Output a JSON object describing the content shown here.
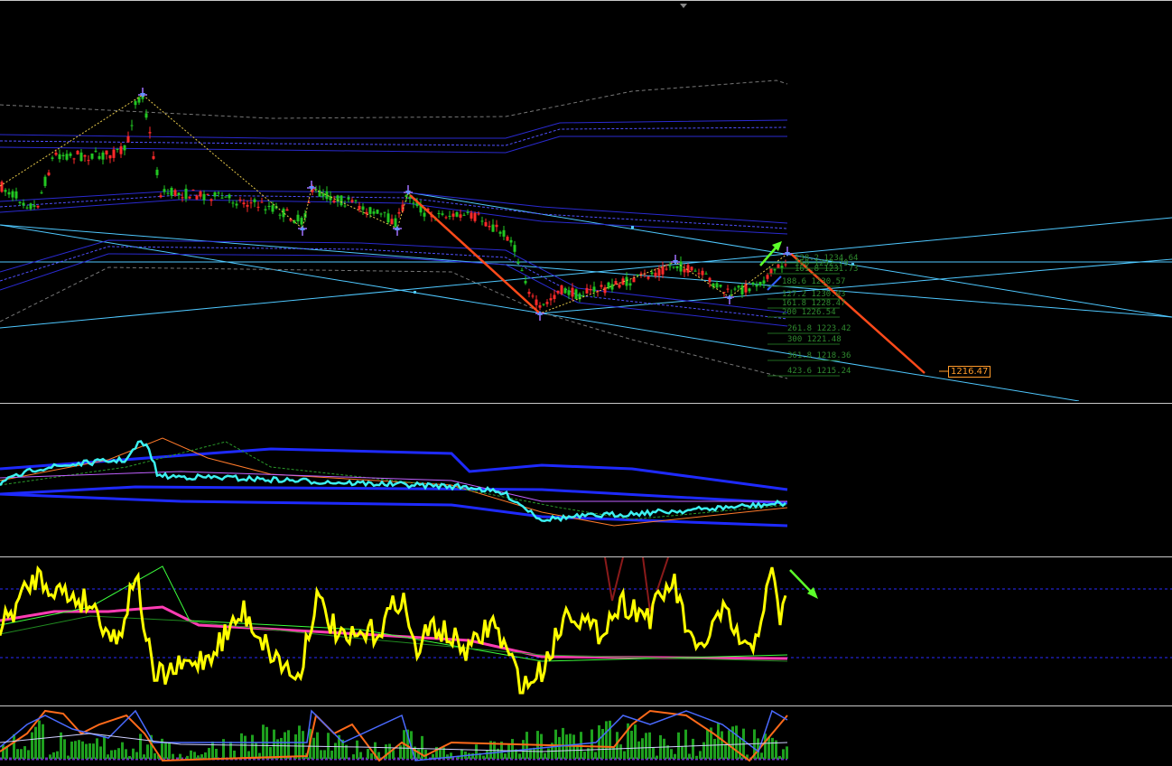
{
  "chart_data": [
    {
      "type": "candlestick",
      "pane": "main",
      "title": "",
      "xlabel": "",
      "ylabel": "",
      "fib_levels": [
        {
          "ratio": "138.2",
          "price": "1234.64"
        },
        {
          "ratio": "150",
          "price": "1232.79"
        },
        {
          "ratio": "161.8",
          "price": "1231.73"
        },
        {
          "ratio": "188.6",
          "price": "1230.57"
        },
        {
          "ratio": "127.2",
          "price": "1230.03"
        },
        {
          "ratio": "161.8",
          "price": "1228.47"
        },
        {
          "ratio": "200",
          "price": "1226.54"
        },
        {
          "ratio": "261.8",
          "price": "1223.42"
        },
        {
          "ratio": "300",
          "price": "1221.48"
        },
        {
          "ratio": "361.8",
          "price": "1218.36"
        },
        {
          "ratio": "423.6",
          "price": "1215.24"
        }
      ],
      "target_price": "1216.47",
      "colors": {
        "bull": "#22c722",
        "bear": "#ff2a2a",
        "trend": "#4fc8ff",
        "projection": "#ff4a1a",
        "zigzag": "#e6c84a"
      }
    },
    {
      "type": "line",
      "pane": "indicator-1",
      "series_colors": [
        "#3cf0f0",
        "#1e2aff",
        "#ff7a2a"
      ]
    },
    {
      "type": "line",
      "pane": "indicator-2",
      "series_colors": [
        "#ffff00",
        "#ff3cb4",
        "#3cff3c"
      ]
    },
    {
      "type": "bar",
      "pane": "indicator-3",
      "series_colors": [
        "#1ea01e",
        "#ff6a1a",
        "#4a6aff"
      ]
    }
  ]
}
